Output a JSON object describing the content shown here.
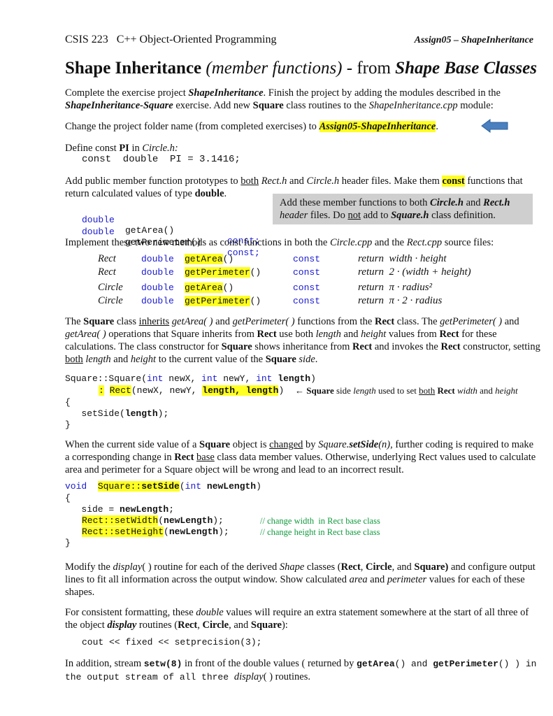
{
  "header": {
    "course": "CSIS 223   C++ Object-Oriented Programming",
    "assignment": "Assign05 – ShapeInheritance"
  },
  "title": {
    "main": "Shape Inheritance",
    "sub": "(member functions)",
    "from": " - from ",
    "base": "Shape Base Classes"
  },
  "intro": {
    "t1": "Complete the exercise project ",
    "t2": "ShapeInheritance",
    "t3": ".  Finish the project by adding the modules described in the ",
    "t4": "ShapeInheritance-Square",
    "t5": " exercise.  Add new ",
    "t6": "Square",
    "t7": " class routines to the ",
    "t8": "ShapeInheritance.cpp",
    "t9": " module:"
  },
  "rename": {
    "t1": "Change the project folder name (from completed exercises) to ",
    "folder": "Assign05-ShapeInheritance",
    "t2": "."
  },
  "pi": {
    "t1": "Define const ",
    "t2": "PI",
    "t3": " in ",
    "t4": "Circle.h:",
    "code": "const  double  PI = 3.1416;"
  },
  "prototypes": {
    "t1": "Add public member function prototypes to ",
    "t2": "both",
    "t3": " ",
    "t4": "Rect.h",
    "t5": " and ",
    "t6": "Circle.h",
    "t7": " header files.  Make them ",
    "t8": "const",
    "t9": " functions that return calculated values of type ",
    "t10": "double",
    "t11": ".",
    "lines": [
      {
        "type": "double",
        "name": "getArea()",
        "qual": "const;"
      },
      {
        "type": "double",
        "name": "getPerimeter()",
        "qual": "const;"
      }
    ],
    "note": {
      "t1": "Add these member functions to both ",
      "t2": "Circle.h",
      "t3": " and ",
      "t4": "Rect.h",
      "t5": "header",
      "t6": " files.  Do ",
      "t7": "not",
      "t8": " add to ",
      "t9": "Square.h",
      "t10": " class definition."
    }
  },
  "implement": {
    "t1": "Implement these two new methods as const functions in both the ",
    "t2": "Circle.cpp",
    "t3": " and the ",
    "t4": "Rect.cpp",
    "t5": " source files:",
    "rows": [
      {
        "cls": "Rect",
        "type": "double",
        "fn": "getArea",
        "paren": "()",
        "qual": "const",
        "formula": "return  width · height"
      },
      {
        "cls": "Rect",
        "type": "double",
        "fn": "getPerimeter",
        "paren": "()",
        "qual": "const",
        "formula": "return  2 · (width + height)"
      },
      {
        "cls": "Circle",
        "type": "double",
        "fn": "getArea",
        "paren": "()",
        "qual": "const",
        "formula": "return  π · radius²"
      },
      {
        "cls": "Circle",
        "type": "double",
        "fn": "getPerimeter",
        "paren": "()",
        "qual": "const",
        "formula": "return  π · 2 · radius"
      }
    ]
  },
  "inherits": {
    "t1": "The ",
    "t2": "Square",
    "t3": " class ",
    "t4": "inherits",
    "t5": " ",
    "t6": "getArea( )",
    "t7": " and ",
    "t8": "getPerimeter( )",
    "t9": " functions from the ",
    "t10": "Rect",
    "t11": " class.  The ",
    "t12": "getPerimeter( )",
    "t13": " and ",
    "t14": "getArea( )",
    "t15": " operations that Square inherits from ",
    "t16": "Rect",
    "t17": " use both ",
    "t18": "length",
    "t19": " and ",
    "t20": "height",
    "t21": " values from ",
    "t22": "Rect",
    "t23": " for these calculations.  The class constructor for ",
    "t24": "Square",
    "t25": " shows inheritance from ",
    "t26": "Rect",
    "t27": " and invokes the ",
    "t28": "Rect",
    "t29": " constructor, setting ",
    "t30": "both",
    "t31": " ",
    "t32": "length",
    "t33": " and ",
    "t34": "height",
    "t35": " to the current value of the ",
    "t36": "Square",
    "t37": " ",
    "t38": "side",
    "t39": "."
  },
  "ctor": {
    "l1a": "Square::Square(",
    "l1b": "int",
    "l1c": " newX, ",
    "l1d": "int",
    "l1e": " newY, ",
    "l1f": "int",
    "l1g": " ",
    "l1h": "length",
    "l1i": ")",
    "l2a": ":",
    "l2b": " ",
    "l2c": "Rect",
    "l2d": "(newX, newY, ",
    "l2e": "length, length",
    "l2f": ")",
    "note1": "← ",
    "note2": "Square",
    "note3": " side ",
    "note4": "length",
    "note5": " used to set ",
    "note6": "both",
    "note7": " ",
    "note8": "Rect",
    "note9": " ",
    "note10": "width",
    "note11": " and ",
    "note12": "height",
    "l3": "{",
    "l4a": "   setSide(",
    "l4b": "length",
    "l4c": ");",
    "l5": "}"
  },
  "setside": {
    "t1": "When the current side value of a ",
    "t2": "Square",
    "t3": " object is ",
    "t4": "changed",
    "t5": " by ",
    "t6": "Square.",
    "t7": "setSide",
    "t8": "(n)",
    "t9": ", further coding is required to make a corresponding change in ",
    "t10": "Rect",
    "t11": " ",
    "t12": "base",
    "t13": " class data member values.  Otherwise, underlying Rect values used to calculate area and perimeter for a Square object will be wrong and lead to an incorrect result."
  },
  "setside_code": {
    "l1a": "void",
    "l1b": "  ",
    "l1c": "Square::",
    "l1d": "setSide",
    "l1e": "(",
    "l1f": "int",
    "l1g": " ",
    "l1h": "newLength",
    "l1i": ")",
    "l2": "{",
    "l3a": "   side = ",
    "l3b": "newLength",
    "l3c": ";",
    "l4a": "Rect::setWidth",
    "l4b": "(",
    "l4c": "newLength",
    "l4d": ");",
    "l4comment": "// change width  in Rect base class",
    "l5a": "Rect::setHeight",
    "l5b": "(",
    "l5c": "newLength",
    "l5d": ");",
    "l5comment": "// change height in Rect base class",
    "l6": "}"
  },
  "display": {
    "t1": "Modify the ",
    "t2": "display",
    "t3": "( ) routine for each of the derived ",
    "t4": "Shape",
    "t5": " classes (",
    "t6": "Rect",
    "t7": ", ",
    "t8": "Circle",
    "t9": ", and ",
    "t10": "Square)",
    "t11": " and configure output lines to fit all information across the output window.  Show calculated ",
    "t12": "area",
    "t13": " and ",
    "t14": "perimeter",
    "t15": " values for each of these shapes."
  },
  "formatting": {
    "t1": "For consistent formatting, these ",
    "t2": "double",
    "t3": " values will require an extra statement somewhere at the start of all three of the object ",
    "t4": "display",
    "t5": " routines (",
    "t6": "Rect",
    "t7": ", ",
    "t8": "Circle",
    "t9": ", and ",
    "t10": "Square",
    "t11": "):",
    "code": "cout << fixed << setprecision(3);"
  },
  "setw": {
    "t1": "In addition, stream ",
    "t2": "setw(8)",
    "t3": " in front of  the double values ( returned by ",
    "t4": "getArea",
    "t5": "() and ",
    "t6": "getPerimeter",
    "t7": "() ) in the output stream of all three ",
    "t8": "display",
    "t9": "( ) routines."
  }
}
